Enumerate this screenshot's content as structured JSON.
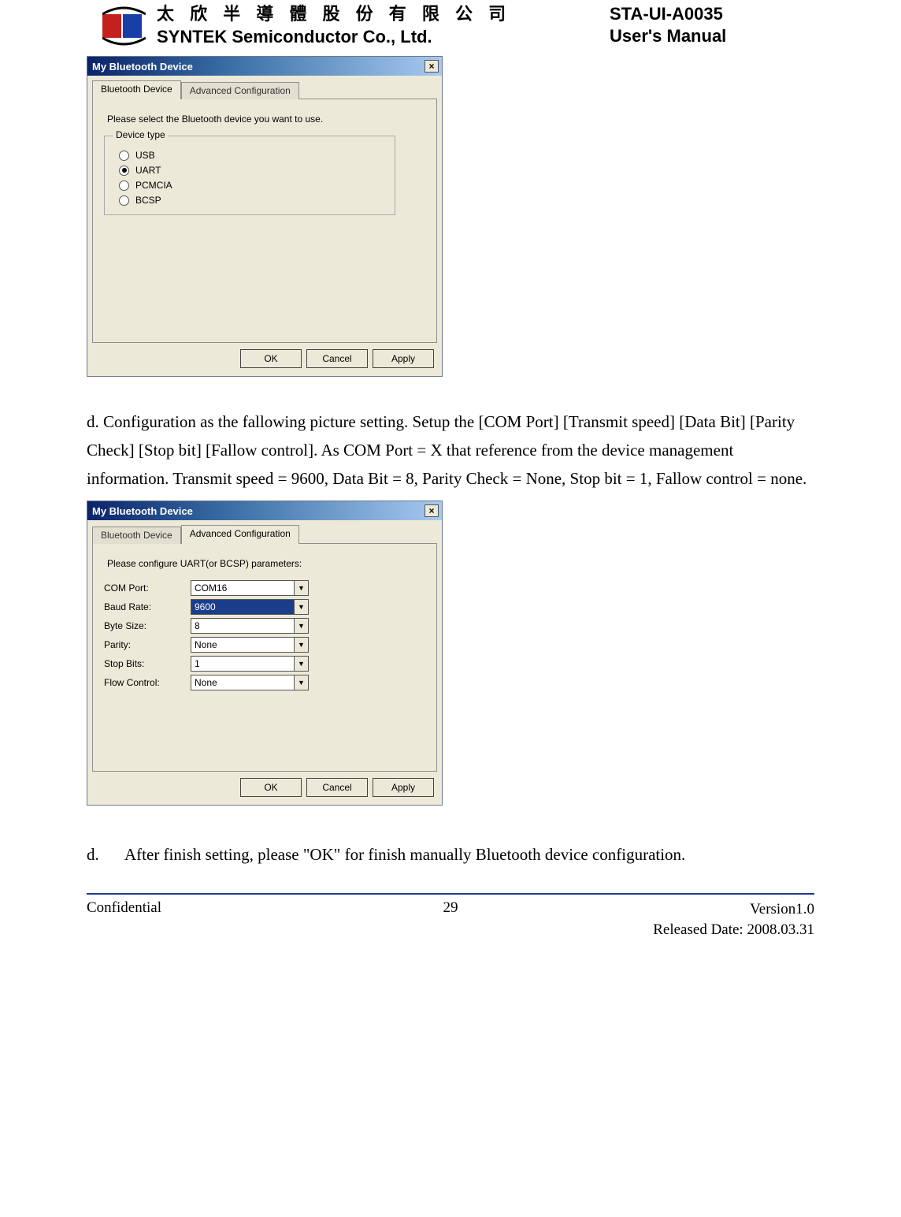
{
  "header": {
    "company_cn": "太 欣 半 導 體 股 份 有 限 公 司",
    "company_en": "SYNTEK Semiconductor Co., Ltd.",
    "doc_code": "STA-UI-A0035",
    "doc_title": "User's Manual"
  },
  "dialog1": {
    "title": "My Bluetooth Device",
    "tabs": {
      "active": "Bluetooth Device",
      "inactive": "Advanced Configuration"
    },
    "prompt": "Please select the Bluetooth device you want to use.",
    "group_legend": "Device type",
    "options": {
      "usb": "USB",
      "uart": "UART",
      "pcmcia": "PCMCIA",
      "bcsp": "BCSP"
    },
    "selected": "uart",
    "buttons": {
      "ok": "OK",
      "cancel": "Cancel",
      "apply": "Apply"
    }
  },
  "paragraph_c": "d. Configuration as the fallowing picture setting. Setup the [COM Port] [Transmit speed] [Data Bit] [Parity Check] [Stop bit] [Fallow control]. As COM Port = X that reference from the device management information. Transmit speed = 9600, Data Bit = 8, Parity Check = None, Stop bit = 1, Fallow control = none.",
  "dialog2": {
    "title": "My Bluetooth Device",
    "tabs": {
      "inactive": "Bluetooth Device",
      "active": "Advanced Configuration"
    },
    "prompt": "Please configure UART(or BCSP) parameters:",
    "fields": {
      "com_port": {
        "label": "COM Port:",
        "value": "COM16"
      },
      "baud_rate": {
        "label": "Baud Rate:",
        "value": "9600",
        "highlight": true
      },
      "byte_size": {
        "label": "Byte Size:",
        "value": "8"
      },
      "parity": {
        "label": "Parity:",
        "value": "None"
      },
      "stop_bits": {
        "label": "Stop Bits:",
        "value": "1"
      },
      "flow_ctl": {
        "label": "Flow Control:",
        "value": "None"
      }
    },
    "buttons": {
      "ok": "OK",
      "cancel": "Cancel",
      "apply": "Apply"
    }
  },
  "paragraph_d": {
    "marker": "d.",
    "text": "After finish setting, please \"OK\" for finish manually Bluetooth device configuration."
  },
  "footer": {
    "left": "Confidential",
    "page": "29",
    "version": "Version1.0",
    "released": "Released Date: 2008.03.31"
  }
}
